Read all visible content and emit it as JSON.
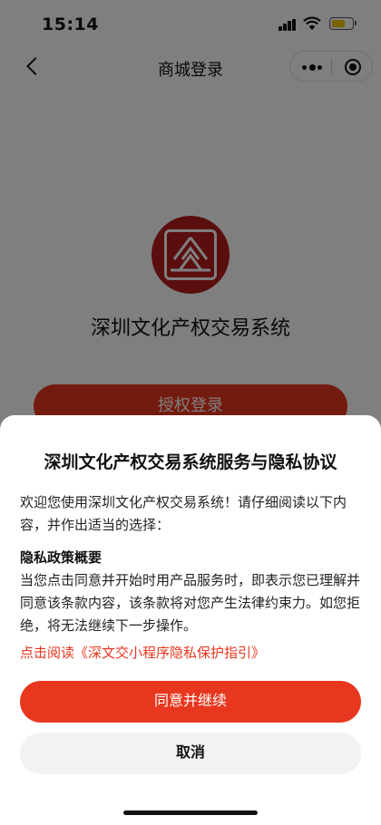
{
  "status_bar": {
    "time": "15:14"
  },
  "nav": {
    "title": "商城登录"
  },
  "app": {
    "name": "深圳文化产权交易系统",
    "auth_button_label": "授权登录"
  },
  "privacy_sheet": {
    "title": "深圳文化产权交易系统服务与隐私协议",
    "intro": "欢迎您使用深圳文化产权交易系统！请仔细阅读以下内容，并作出适当的选择：",
    "section_heading": "隐私政策概要",
    "section_body": "当您点击同意并开始时用产品服务时，即表示您已理解并同意该条款内容，该条款将对您产生法律约束力。如您拒绝，将无法继续下一步操作。",
    "link_text": "点击阅读《深文交小程序隐私保护指引》",
    "agree_label": "同意并继续",
    "cancel_label": "取消"
  },
  "colors": {
    "accent": "#e8371f",
    "logo": "#b71d1d",
    "battery": "#f5c400"
  }
}
